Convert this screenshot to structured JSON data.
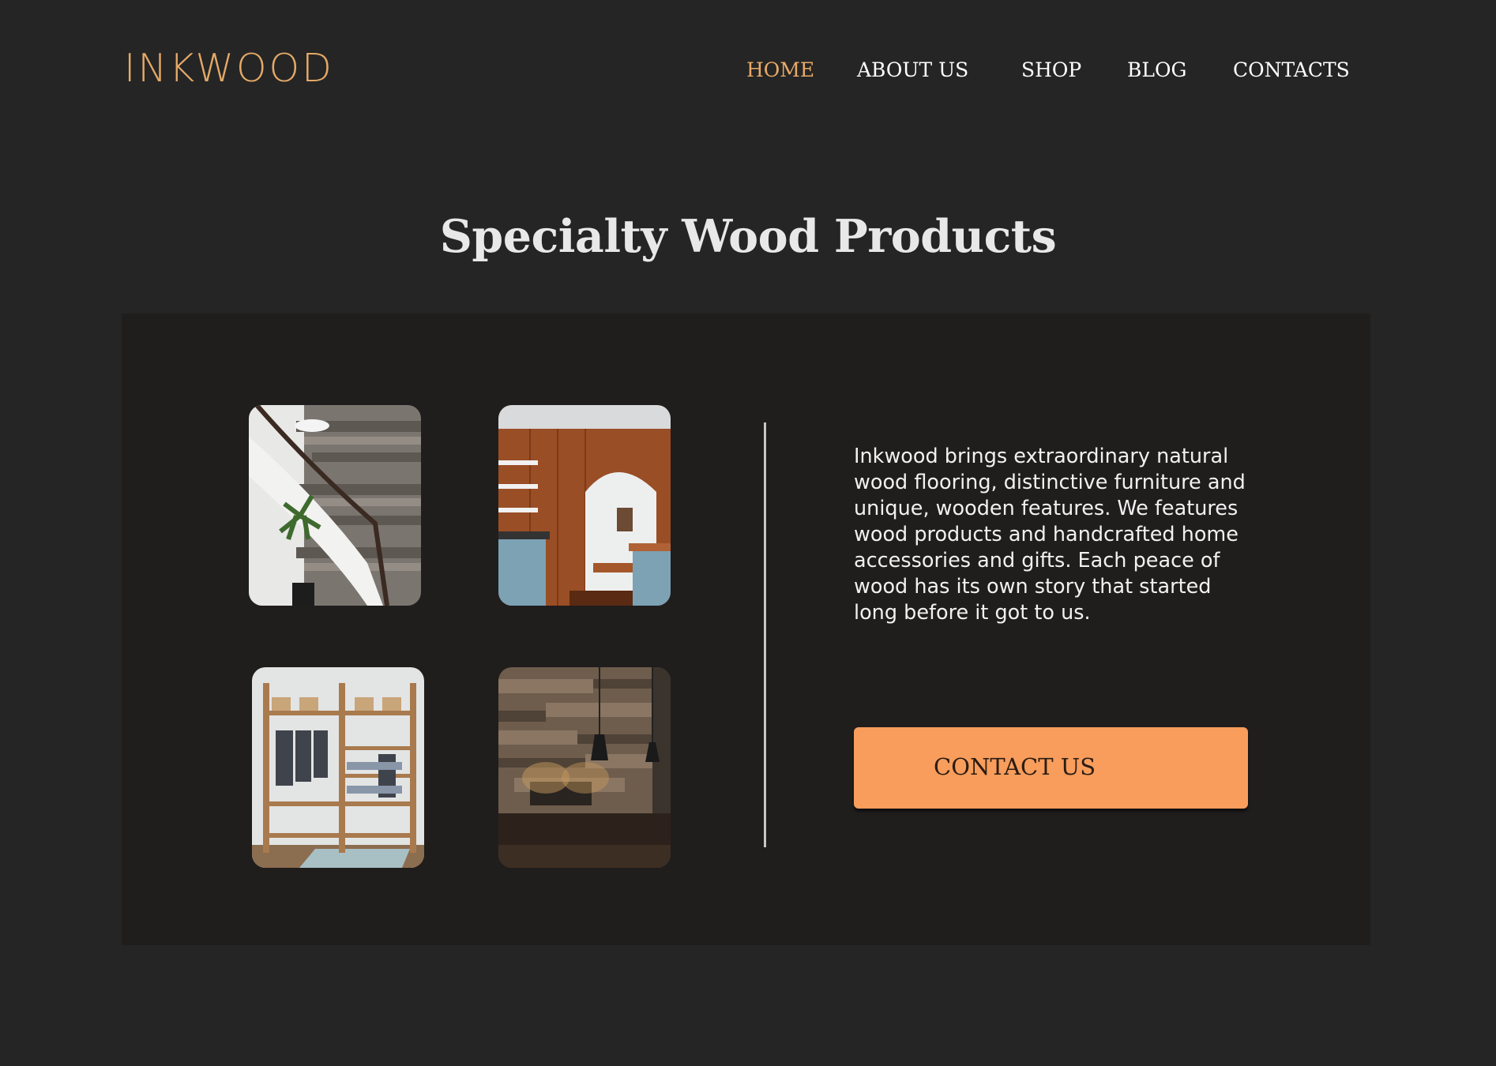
{
  "header": {
    "logo": "INKWOOD",
    "nav": [
      {
        "label": "HOME",
        "active": true
      },
      {
        "label": "ABOUT US",
        "active": false
      },
      {
        "label": "SHOP",
        "active": false
      },
      {
        "label": "BLOG",
        "active": false
      },
      {
        "label": "CONTACTS",
        "active": false
      }
    ]
  },
  "main": {
    "title": "Specialty Wood Products",
    "description": "Inkwood brings extraordinary natural wood flooring, distinctive furniture and unique,  wooden features. We features wood products and handcrafted home accessories and gifts. Each peace of wood has its own story that started long before it got to us.",
    "cta_label": "CONTACT US",
    "gallery": [
      {
        "icon": "staircase-photo"
      },
      {
        "icon": "kitchen-photo"
      },
      {
        "icon": "wardrobe-shelf-photo"
      },
      {
        "icon": "wood-wall-room-photo"
      }
    ]
  },
  "colors": {
    "background": "#252525",
    "panel": "#201D1D",
    "accent": "#F89D5C",
    "nav_active": "#E9A968",
    "logo": "#E4A968"
  }
}
